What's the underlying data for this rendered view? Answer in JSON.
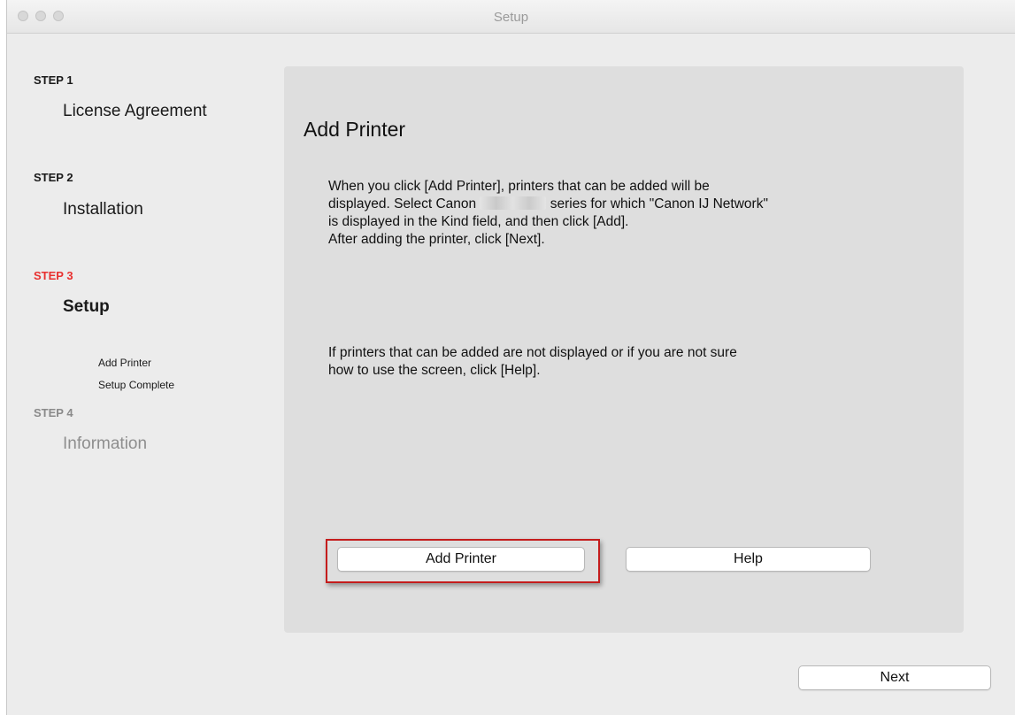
{
  "window": {
    "title": "Setup"
  },
  "sidebar": {
    "steps": [
      {
        "label": "STEP 1",
        "name": "License Agreement"
      },
      {
        "label": "STEP 2",
        "name": "Installation"
      },
      {
        "label": "STEP 3",
        "name": "Setup",
        "sub_items": [
          "Add Printer",
          "Setup Complete"
        ]
      },
      {
        "label": "STEP 4",
        "name": "Information"
      }
    ]
  },
  "main": {
    "title": "Add Printer",
    "paragraph1_part1": "When you click [Add Printer], printers that can be added will be\ndisplayed. Select Canon ",
    "paragraph1_part2": " series for which \"Canon IJ Network\"\nis displayed in the Kind field, and then click [Add].\nAfter adding the printer, click [Next].",
    "paragraph2": "If printers that can be added are not displayed or if you are not sure\nhow to use the screen, click [Help].",
    "add_printer_button": "Add Printer",
    "help_button": "Help"
  },
  "footer": {
    "next_button": "Next"
  },
  "colors": {
    "current_step": "#e8302f",
    "highlight_border": "#c41c1c",
    "panel_bg": "#dedede"
  }
}
